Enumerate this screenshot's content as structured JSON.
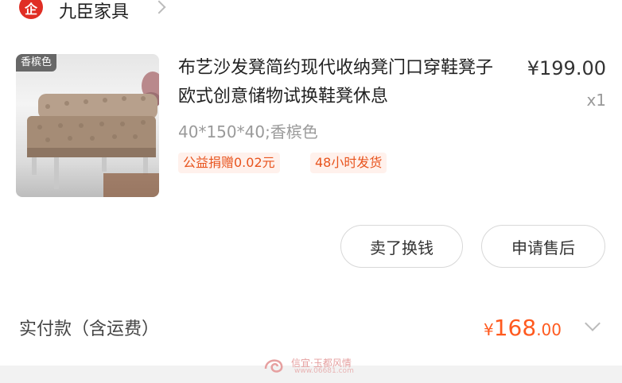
{
  "shop": {
    "badge": "企",
    "name": "九臣家具"
  },
  "product": {
    "image_tag": "香槟色",
    "title": "布艺沙发凳简约现代收纳凳门口穿鞋凳子欧式创意储物试换鞋凳休息",
    "price": "¥199.00",
    "quantity": "x1",
    "sku": "40*150*40;香槟色",
    "tags": [
      "公益捐赠0.02元",
      "48小时发货"
    ]
  },
  "actions": {
    "sell_label": "卖了换钱",
    "after_sale_label": "申请售后"
  },
  "payment": {
    "label": "实付款（含运费）",
    "symbol": "¥",
    "amount_int": "168",
    "amount_dec": ".00"
  },
  "watermark": {
    "text": "信宜·玉都风情",
    "url": "www.06681.com"
  },
  "colors": {
    "accent": "#ff5a1f",
    "brand_red": "#e02e24",
    "tag_bg": "#fff1ec"
  }
}
